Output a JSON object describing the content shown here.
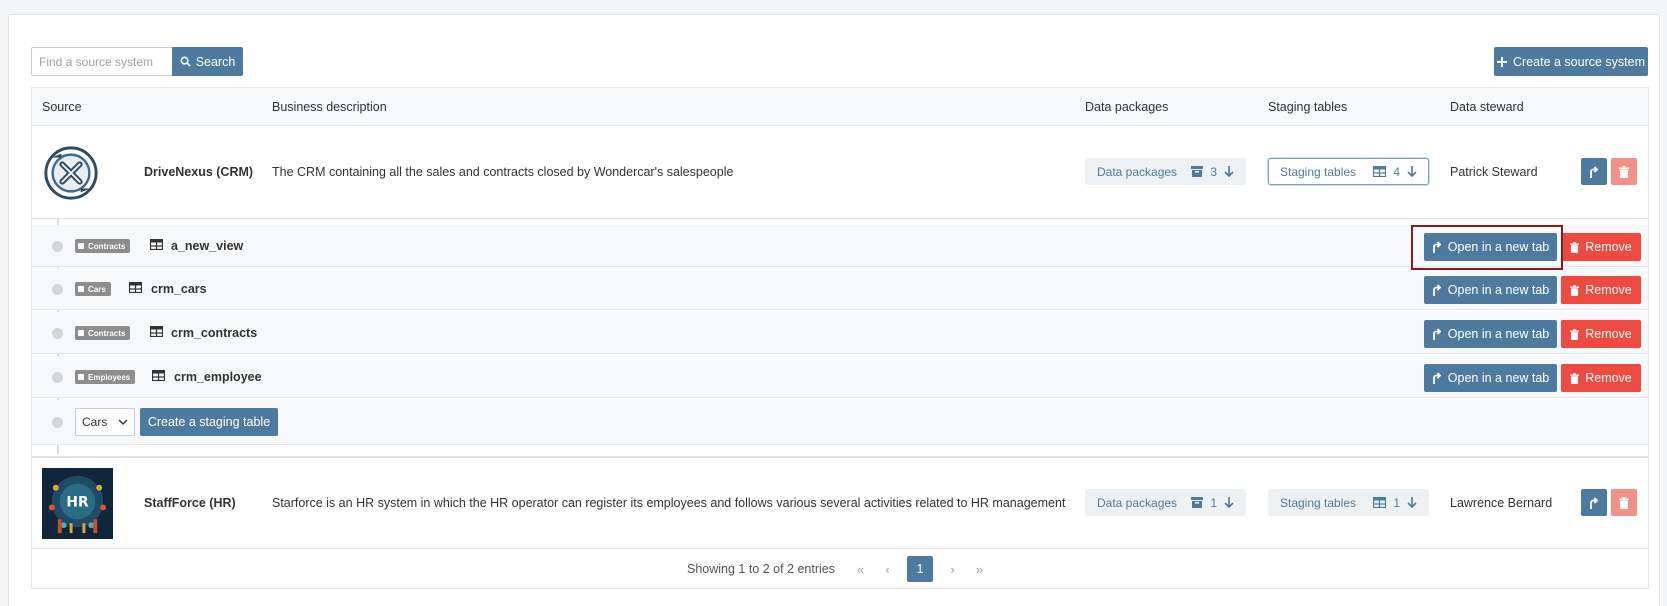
{
  "search": {
    "placeholder": "Find a source system",
    "button_label": "Search"
  },
  "create_source_label": "Create a source system",
  "table": {
    "headers": [
      "Source",
      "Business description",
      "Data packages",
      "Staging tables",
      "Data steward"
    ]
  },
  "sources": [
    {
      "name": "DriveNexus (CRM)",
      "description": "The CRM containing all the sales and contracts closed by Wondercar's salespeople",
      "data_packages_label": "Data packages",
      "data_packages_count": "3",
      "staging_tables_label": "Staging tables",
      "staging_tables_count": "4",
      "steward": "Patrick Steward",
      "logo_icon": "drivenexus-logo-icon"
    },
    {
      "name": "StaffForce (HR)",
      "description": "Starforce is an HR system in which the HR operator can register its employees and follows various several activities related to HR management",
      "data_packages_label": "Data packages",
      "data_packages_count": "1",
      "staging_tables_label": "Staging tables",
      "staging_tables_count": "1",
      "steward": "Lawrence Bernard",
      "logo_icon": "staffforce-hr-logo-icon",
      "logo_text": "HR"
    }
  ],
  "staging_tables": [
    {
      "tag": "Contracts",
      "name": "a_new_view"
    },
    {
      "tag": "Cars",
      "name": "crm_cars"
    },
    {
      "tag": "Contracts",
      "name": "crm_contracts"
    },
    {
      "tag": "Employees",
      "name": "crm_employee"
    }
  ],
  "row_actions": {
    "open_label": "Open in a new tab",
    "remove_label": "Remove"
  },
  "create_staging": {
    "selected_option": "Cars",
    "button_label": "Create a staging table"
  },
  "pagination": {
    "info": "Showing 1 to 2 of 2 entries",
    "first": "«",
    "prev": "‹",
    "current_page": "1",
    "next": "›",
    "last": "»"
  },
  "colors": {
    "primary": "#4f7aa0",
    "danger": "#ef4a42",
    "danger_light": "#f1918a",
    "highlight_border": "#8a1c1c"
  }
}
